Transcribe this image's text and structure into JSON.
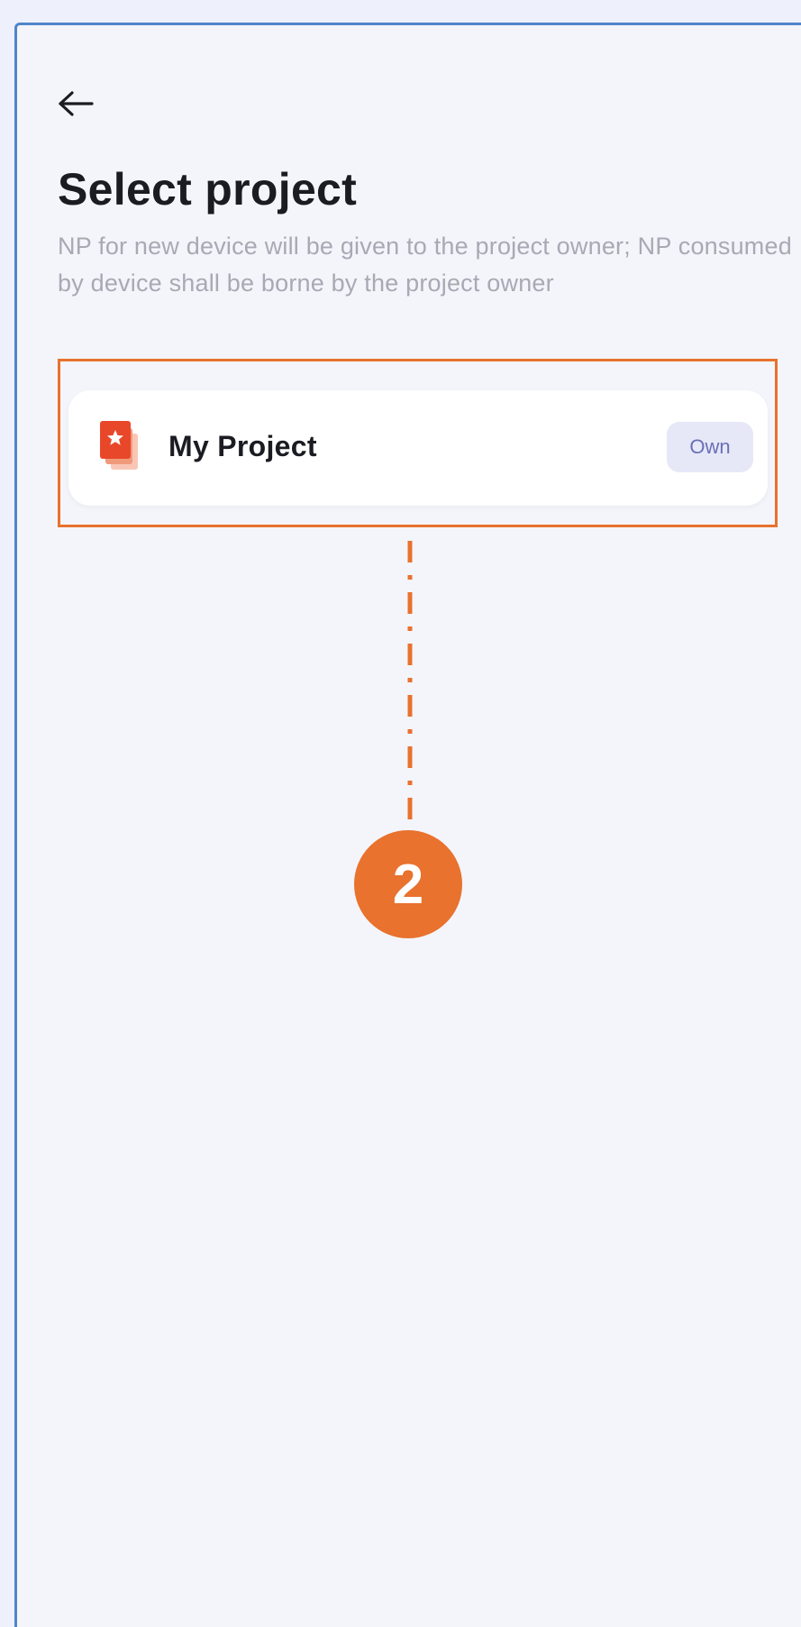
{
  "header": {
    "back_icon": "arrow-left-icon",
    "title": "Select project",
    "subtitle": "NP for new device will be given to the project owner; NP consumed by device shall be borne by the project owner"
  },
  "projects": [
    {
      "icon": "project-document-icon",
      "name": "My Project",
      "badge": "Own"
    }
  ],
  "annotation": {
    "step_number": "2"
  },
  "colors": {
    "accent": "#e8722e",
    "background": "#f4f5fa",
    "badge_bg": "#e6e8f8",
    "badge_text": "#6a6fb5",
    "subtitle_text": "#a7aab4"
  }
}
